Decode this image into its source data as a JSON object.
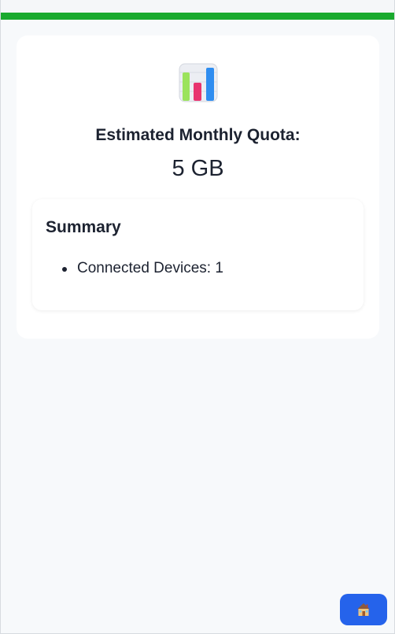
{
  "progress": {
    "fraction": 1.0,
    "color": "#1aaa2e"
  },
  "card": {
    "icon": "bar-chart-icon",
    "quota_label": "Estimated Monthly Quota:",
    "quota_value": "5 GB"
  },
  "summary": {
    "title": "Summary",
    "items": [
      "Connected Devices: 1"
    ]
  },
  "home_button": {
    "icon": "house-icon",
    "color": "#2563eb"
  }
}
